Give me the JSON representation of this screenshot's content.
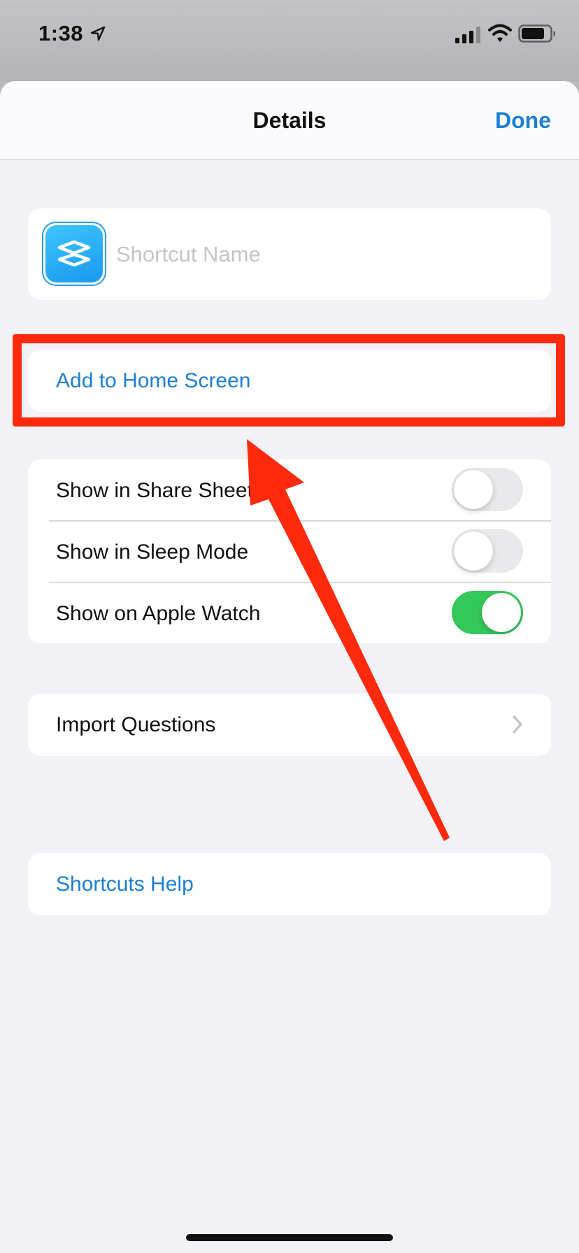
{
  "status_bar": {
    "time": "1:38",
    "icons": [
      "location-arrow-icon",
      "cellular-signal-icon",
      "wifi-icon",
      "battery-icon"
    ]
  },
  "nav": {
    "title": "Details",
    "done_label": "Done"
  },
  "shortcut": {
    "icon": "shortcuts-app-icon",
    "name_value": "",
    "name_placeholder": "Shortcut Name"
  },
  "add_home": {
    "label": "Add to Home Screen"
  },
  "toggles": [
    {
      "label": "Show in Share Sheet",
      "on": false
    },
    {
      "label": "Show in Sleep Mode",
      "on": false
    },
    {
      "label": "Show on Apple Watch",
      "on": true
    }
  ],
  "import": {
    "label": "Import Questions",
    "icon": "chevron-right-icon"
  },
  "help": {
    "label": "Shortcuts Help"
  },
  "annotation": {
    "color": "#ff2a0d",
    "shapes": [
      "highlight-box",
      "arrow"
    ]
  },
  "colors": {
    "accent": "#1b7fd6",
    "toggle_on": "#34c759",
    "toggle_off": "#e9e9eb"
  }
}
